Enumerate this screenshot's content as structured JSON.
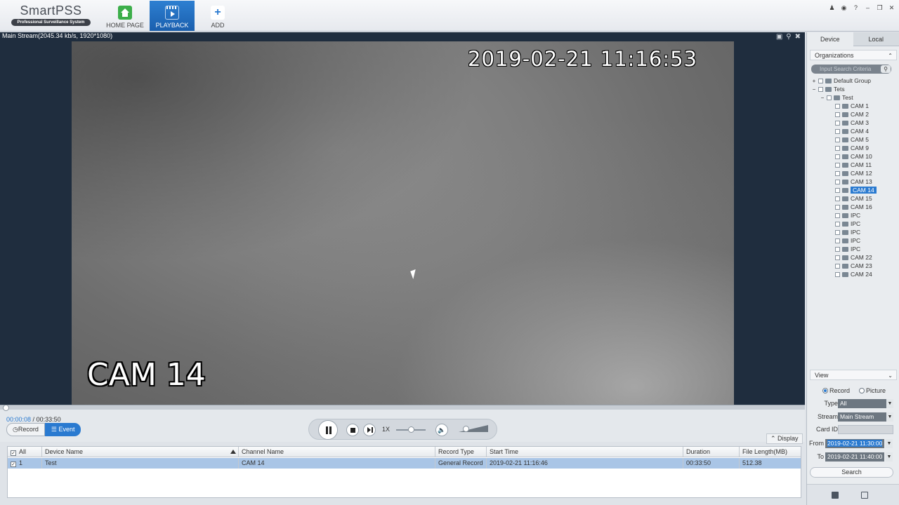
{
  "app": {
    "logo_name": "SmartPSS",
    "logo_tagline": "Professional Surveillance System"
  },
  "nav": {
    "home": "HOME PAGE",
    "playback": "PLAYBACK",
    "add": "ADD"
  },
  "window_controls": [
    "user-icon",
    "lock-icon",
    "help-icon",
    "minimize-icon",
    "restore-icon",
    "close-icon"
  ],
  "video": {
    "stream_info": "Main Stream(2045.34 kb/s, 1920*1080)",
    "osd_timestamp": "2019-02-21  11:16:53",
    "osd_camera": "CAM 14"
  },
  "playback": {
    "current_time": "00:00:08",
    "separator": " / ",
    "total_time": "00:33:50",
    "mode_record": "Record",
    "mode_event": "Event",
    "speed": "1X",
    "display": "Display"
  },
  "table": {
    "headers": {
      "all": "All",
      "device": "Device Name",
      "channel": "Channel Name",
      "record_type": "Record Type",
      "start_time": "Start Time",
      "duration": "Duration",
      "file_length": "File Length(MB)"
    },
    "rows": [
      {
        "index": "1",
        "device": "Test",
        "channel": "CAM 14",
        "record_type": "General Record",
        "start_time": "2019-02-21 11:16:46",
        "duration": "00:33:50",
        "file_length": "512.38"
      }
    ]
  },
  "panel": {
    "tab_device": "Device",
    "tab_local": "Local",
    "organizations": "Organizations",
    "search_placeholder": "Input Search Criteria",
    "tree": {
      "default_group": "Default Group",
      "tets": "Tets",
      "test": "Test",
      "cams": [
        "CAM 1",
        "CAM 2",
        "CAM 3",
        "CAM 4",
        "CAM 5",
        "CAM 9",
        "CAM 10",
        "CAM 11",
        "CAM 12",
        "CAM 13",
        "CAM 14",
        "CAM 15",
        "CAM 16",
        "IPC",
        "IPC",
        "IPC",
        "IPC",
        "IPC",
        "CAM 22",
        "CAM 23",
        "CAM 24"
      ],
      "selected": "CAM 14"
    },
    "view": "View",
    "radio_record": "Record",
    "radio_picture": "Picture",
    "type_label": "Type",
    "type_value": "All",
    "stream_label": "Stream",
    "stream_value": "Main Stream",
    "card_label": "Card ID",
    "card_value": "",
    "from_label": "From",
    "from_value": "2019-02-21 11:30:00",
    "to_label": "To",
    "to_value": "2019-02-21 11:40:00",
    "search_button": "Search"
  }
}
